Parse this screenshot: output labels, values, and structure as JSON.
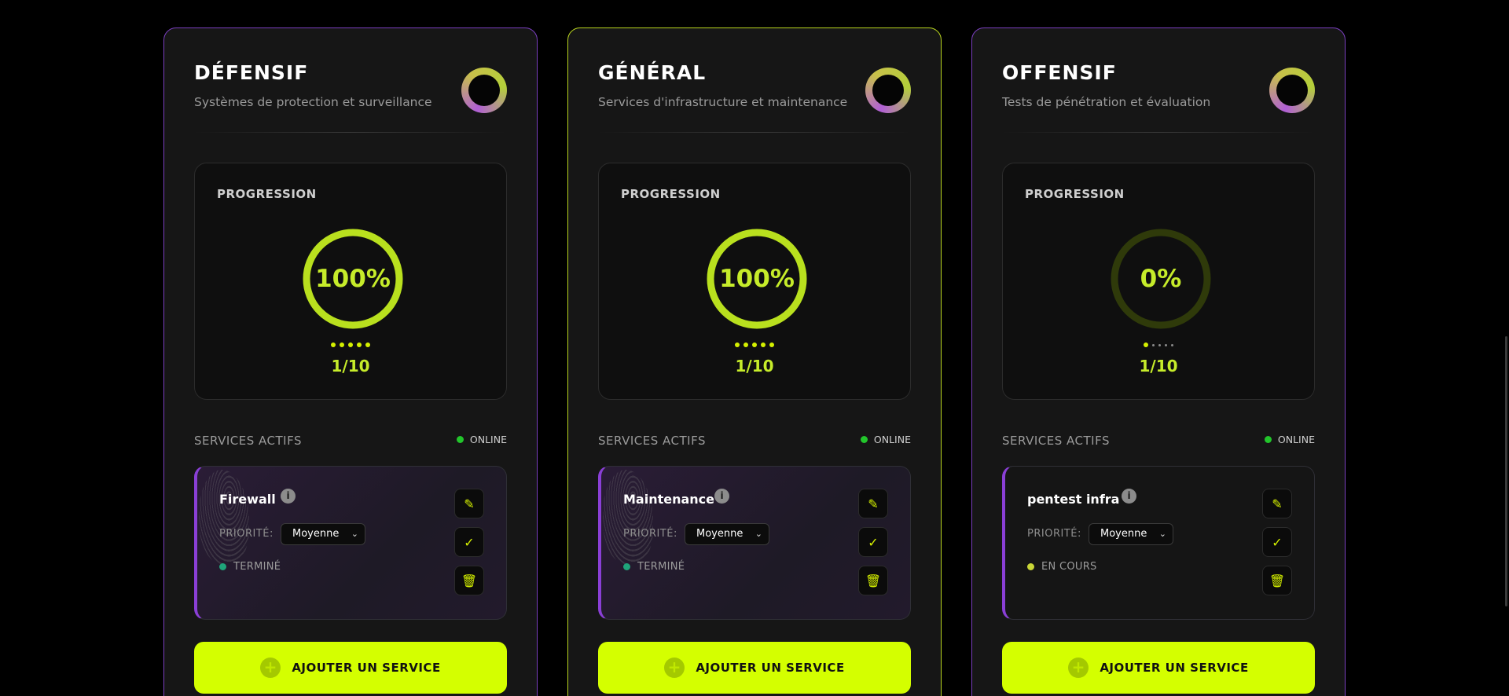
{
  "colors": {
    "accent": "#d4ff00",
    "purple": "#8a3fd6",
    "lime_border": "#b8d31e",
    "online": "#22c52b"
  },
  "columns": [
    {
      "title": "DÉFENSIF",
      "subtitle": "Systèmes de protection et surveillance",
      "progress_label": "PROGRESSION",
      "progress_percent": 100,
      "progress_text": "100%",
      "count_text": "1/10",
      "dots_active": 5,
      "services_label": "SERVICES ACTIFS",
      "online_label": "ONLINE",
      "service": {
        "name": "Firewall",
        "priority_label": "PRIORITÉ:",
        "priority_value": "Moyenne",
        "status": "TERMINÉ",
        "done": true
      },
      "add_label": "AJOUTER UN SERVICE"
    },
    {
      "title": "GÉNÉRAL",
      "subtitle": "Services d'infrastructure et maintenance",
      "progress_label": "PROGRESSION",
      "progress_percent": 100,
      "progress_text": "100%",
      "count_text": "1/10",
      "dots_active": 5,
      "services_label": "SERVICES ACTIFS",
      "online_label": "ONLINE",
      "service": {
        "name": "Maintenance",
        "priority_label": "PRIORITÉ:",
        "priority_value": "Moyenne",
        "status": "TERMINÉ",
        "done": true
      },
      "add_label": "AJOUTER UN SERVICE"
    },
    {
      "title": "OFFENSIF",
      "subtitle": "Tests de pénétration et évaluation",
      "progress_label": "PROGRESSION",
      "progress_percent": 0,
      "progress_text": "0%",
      "count_text": "1/10",
      "dots_active": 1,
      "services_label": "SERVICES ACTIFS",
      "online_label": "ONLINE",
      "service": {
        "name": "pentest infra",
        "priority_label": "PRIORITÉ:",
        "priority_value": "Moyenne",
        "status": "EN COURS",
        "done": false
      },
      "add_label": "AJOUTER UN SERVICE"
    }
  ]
}
